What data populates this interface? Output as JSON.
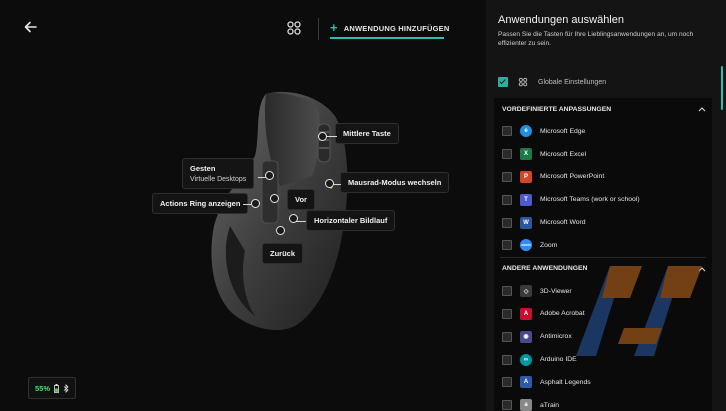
{
  "header": {
    "add_app_label": "ANWENDUNG HINZUFÜGEN",
    "icons": [
      "back-arrow-icon",
      "grid-icon",
      "plus-icon"
    ]
  },
  "callouts": {
    "middle_button": "Mittlere Taste",
    "gestures_title": "Gesten",
    "gestures_sub": "Virtuelle Desktops",
    "actions_ring": "Actions Ring anzeigen",
    "forward": "Vor",
    "wheel_mode": "Mausrad-Modus wechseln",
    "horizontal_scroll": "Horizontaler Bildlauf",
    "back": "Zurück"
  },
  "battery": {
    "percent": "55%",
    "icons": [
      "battery-icon",
      "bluetooth-icon"
    ]
  },
  "panel": {
    "title": "Anwendungen auswählen",
    "description": "Passen Sie die Tasten für Ihre Lieblingsanwendungen an, um noch effizienter zu sein.",
    "global_label": "Globale Einstellungen",
    "sections": [
      {
        "title": "VORDEFINIERTE ANPASSUNGEN",
        "items": [
          {
            "label": "Microsoft Edge",
            "icon": "edge-icon",
            "color": "#1f8fe0"
          },
          {
            "label": "Microsoft Excel",
            "icon": "excel-icon",
            "color": "#1d7a45"
          },
          {
            "label": "Microsoft PowerPoint",
            "icon": "powerpoint-icon",
            "color": "#d24726"
          },
          {
            "label": "Microsoft Teams (work or school)",
            "icon": "teams-icon",
            "color": "#5059c9"
          },
          {
            "label": "Microsoft Word",
            "icon": "word-icon",
            "color": "#2b579a"
          },
          {
            "label": "Zoom",
            "icon": "zoom-icon",
            "color": "#2d8cff"
          }
        ]
      },
      {
        "title": "ANDERE ANWENDUNGEN",
        "items": [
          {
            "label": "3D-Viewer",
            "icon": "3d-viewer-icon",
            "color": "#3a3a3a"
          },
          {
            "label": "Adobe Acrobat",
            "icon": "acrobat-icon",
            "color": "#c8102e"
          },
          {
            "label": "Antimicrox",
            "icon": "gamepad-icon",
            "color": "#4a4a8a"
          },
          {
            "label": "Arduino IDE",
            "icon": "arduino-icon",
            "color": "#00979d"
          },
          {
            "label": "Asphalt Legends",
            "icon": "asphalt-icon",
            "color": "#2a5aa8"
          },
          {
            "label": "aTrain",
            "icon": "atrain-icon",
            "color": "#888888"
          }
        ]
      }
    ]
  },
  "colors": {
    "accent": "#29c0b0",
    "battery": "#4ee06b"
  }
}
